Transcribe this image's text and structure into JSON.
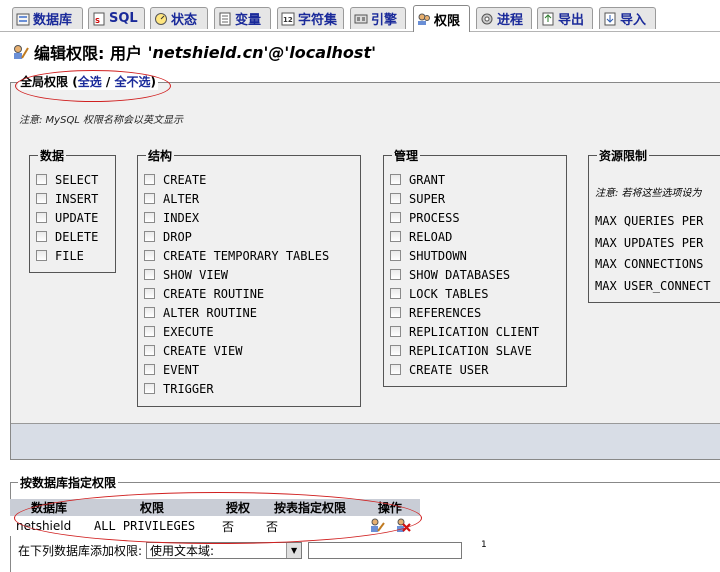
{
  "tabs": [
    {
      "label": "数据库",
      "icon": "database-icon"
    },
    {
      "label": "SQL",
      "icon": "sql-icon"
    },
    {
      "label": "状态",
      "icon": "status-icon"
    },
    {
      "label": "变量",
      "icon": "variables-icon"
    },
    {
      "label": "字符集",
      "icon": "charset-icon"
    },
    {
      "label": "引擎",
      "icon": "engines-icon"
    },
    {
      "label": "权限",
      "icon": "privileges-icon"
    },
    {
      "label": "进程",
      "icon": "processes-icon"
    },
    {
      "label": "导出",
      "icon": "export-icon"
    },
    {
      "label": "导入",
      "icon": "import-icon"
    }
  ],
  "active_tab": "权限",
  "title": {
    "prefix": "编辑权限: 用户 ",
    "user": "'netshield.cn'@'localhost'"
  },
  "global": {
    "legend": "全局权限",
    "check_all": "全选",
    "separator": " / ",
    "uncheck_all": "全不选",
    "open_paren": " (",
    "close_paren": ")",
    "note": "注意: MySQL 权限名称会以英文显示",
    "groups": {
      "data": {
        "label": "数据",
        "items": [
          "SELECT",
          "INSERT",
          "UPDATE",
          "DELETE",
          "FILE"
        ]
      },
      "structure": {
        "label": "结构",
        "items": [
          "CREATE",
          "ALTER",
          "INDEX",
          "DROP",
          "CREATE TEMPORARY TABLES",
          "SHOW VIEW",
          "CREATE ROUTINE",
          "ALTER ROUTINE",
          "EXECUTE",
          "CREATE VIEW",
          "EVENT",
          "TRIGGER"
        ]
      },
      "admin": {
        "label": "管理",
        "items": [
          "GRANT",
          "SUPER",
          "PROCESS",
          "RELOAD",
          "SHUTDOWN",
          "SHOW DATABASES",
          "LOCK TABLES",
          "REFERENCES",
          "REPLICATION CLIENT",
          "REPLICATION SLAVE",
          "CREATE USER"
        ]
      },
      "limits": {
        "label": "资源限制",
        "note": "注意: 若将这些选项设为",
        "items": [
          "MAX QUERIES PER",
          "MAX UPDATES PER",
          "MAX CONNECTIONS",
          "MAX USER_CONNECT"
        ]
      }
    }
  },
  "db_specific": {
    "legend": "按数据库指定权限",
    "headers": [
      "数据库",
      "权限",
      "授权",
      "按表指定权限",
      "操作"
    ],
    "rows": [
      {
        "database": "netshield",
        "privileges": "ALL PRIVILEGES",
        "grant": "否",
        "table_specific": "否"
      }
    ],
    "add_label": "在下列数据库添加权限:",
    "select_value": "使用文本域:",
    "superscript": "1"
  }
}
